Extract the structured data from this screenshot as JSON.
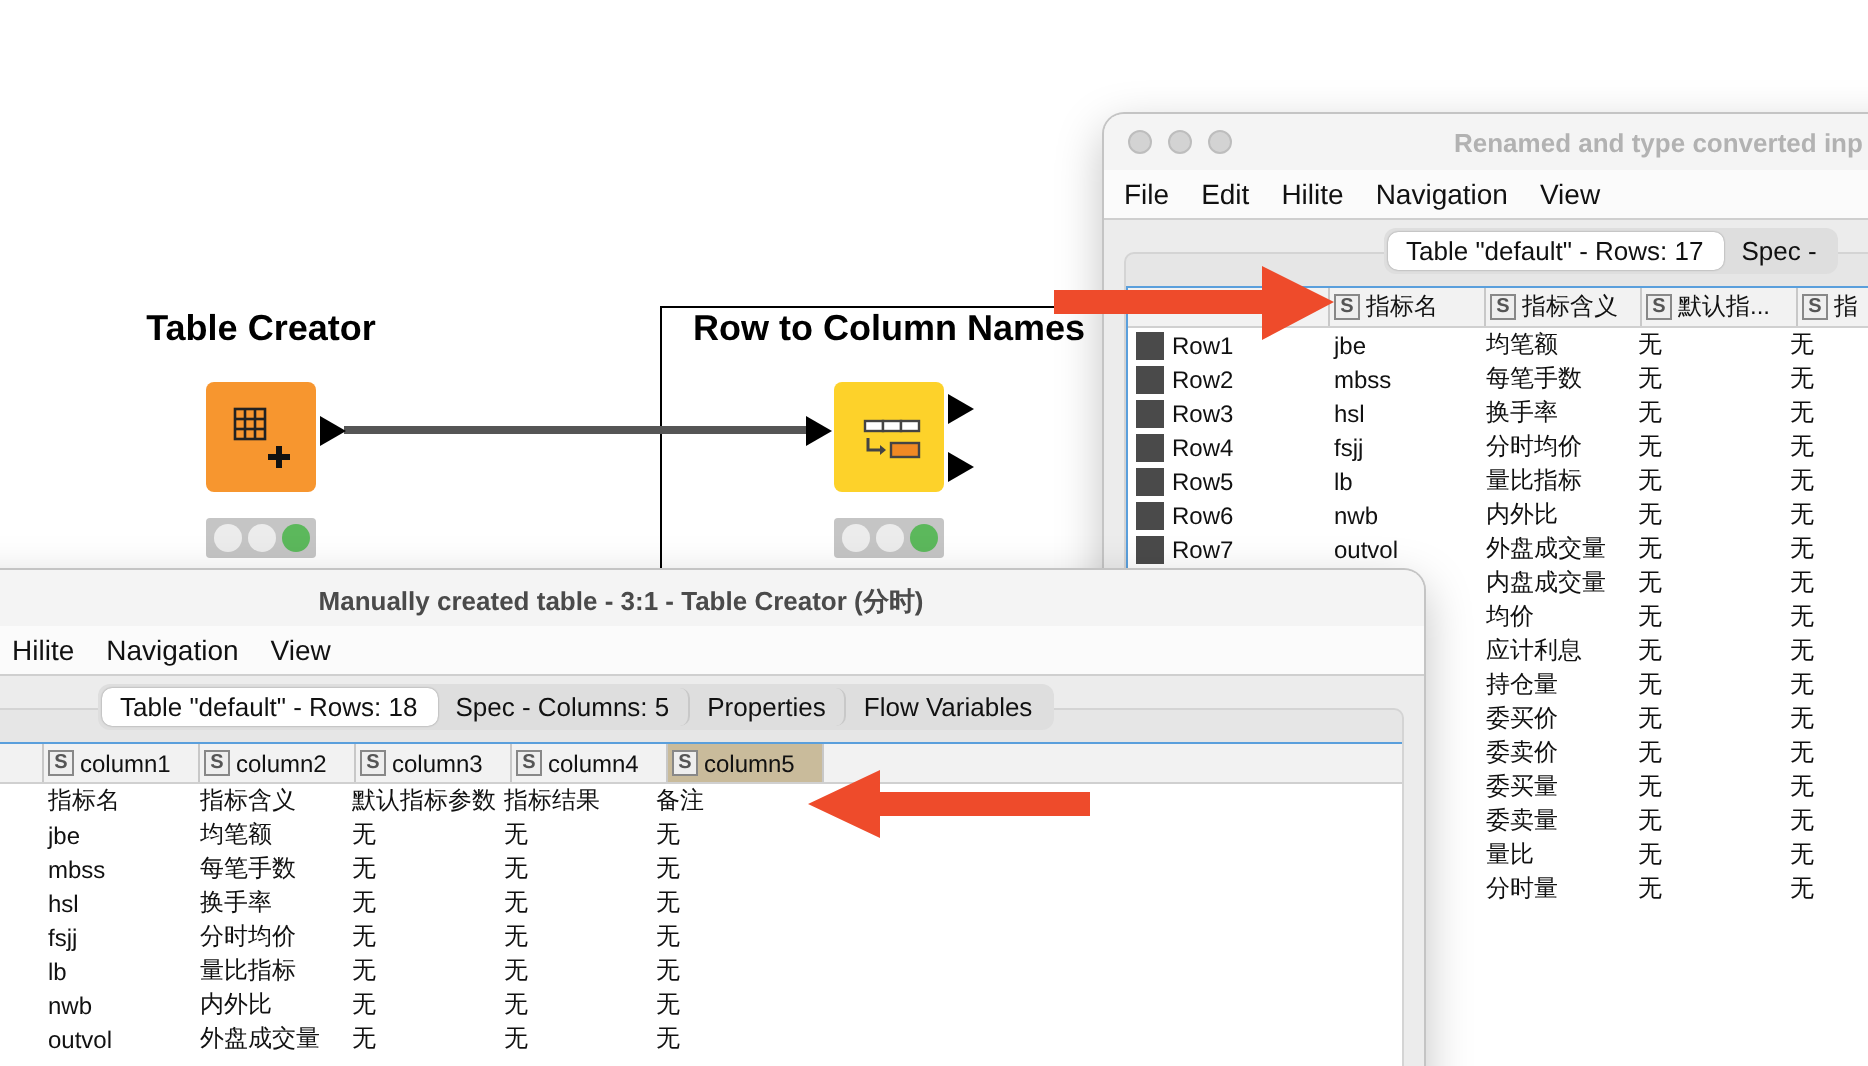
{
  "canvas": {
    "nodes": [
      {
        "label": "Table Creator",
        "kind": "table-creator",
        "lights": [
          {
            "on": false
          },
          {
            "on": false
          },
          {
            "on": true
          }
        ]
      },
      {
        "label": "Row to Column Names",
        "kind": "row-to-column-names",
        "lights": [
          {
            "on": false
          },
          {
            "on": false
          },
          {
            "on": true
          }
        ]
      }
    ]
  },
  "windows": [
    {
      "title": "Renamed and type converted inp",
      "active": false,
      "menu": [
        "File",
        "Edit",
        "Hilite",
        "Navigation",
        "View"
      ],
      "tabs": [
        {
          "label": "Table \"default\" - Rows: 17",
          "selected": true
        },
        {
          "label": "Spec -",
          "selected": false
        }
      ],
      "table": {
        "columns": [
          {
            "type": "S",
            "name": "指标名",
            "selected": false
          },
          {
            "type": "S",
            "name": "指标含义",
            "selected": false
          },
          {
            "type": "S",
            "name": "默认指...",
            "selected": false
          },
          {
            "type": "S",
            "name": "指",
            "selected": false
          }
        ],
        "rows": [
          {
            "row_id": "Row1",
            "cells": [
              "jbe",
              "均笔额",
              "无",
              "无"
            ]
          },
          {
            "row_id": "Row2",
            "cells": [
              "mbss",
              "每笔手数",
              "无",
              "无"
            ]
          },
          {
            "row_id": "Row3",
            "cells": [
              "hsl",
              "换手率",
              "无",
              "无"
            ]
          },
          {
            "row_id": "Row4",
            "cells": [
              "fsjj",
              "分时均价",
              "无",
              "无"
            ]
          },
          {
            "row_id": "Row5",
            "cells": [
              "lb",
              "量比指标",
              "无",
              "无"
            ]
          },
          {
            "row_id": "Row6",
            "cells": [
              "nwb",
              "内外比",
              "无",
              "无"
            ]
          },
          {
            "row_id": "Row7",
            "cells": [
              "outvol",
              "外盘成交量",
              "无",
              "无"
            ]
          },
          {
            "cells": [
              "内盘成交量",
              "无",
              "无"
            ]
          },
          {
            "cells": [
              "均价",
              "无",
              "无"
            ]
          },
          {
            "cells": [
              "应计利息",
              "无",
              "无"
            ]
          },
          {
            "cells": [
              "持仓量",
              "无",
              "无"
            ]
          },
          {
            "cells": [
              "委买价",
              "无",
              "无"
            ]
          },
          {
            "cells": [
              "委卖价",
              "无",
              "无"
            ]
          },
          {
            "cells": [
              "委买量",
              "无",
              "无"
            ]
          },
          {
            "cells": [
              "委卖量",
              "无",
              "无"
            ]
          },
          {
            "cells": [
              "量比",
              "无",
              "无"
            ]
          },
          {
            "cells": [
              "分时量",
              "无",
              "无"
            ]
          }
        ]
      }
    },
    {
      "title": "Manually created table - 3:1 - Table Creator (分时)",
      "active": true,
      "menu": [
        "Hilite",
        "Navigation",
        "View"
      ],
      "tabs": [
        {
          "label": "Table \"default\" - Rows: 18",
          "selected": true
        },
        {
          "label": "Spec - Columns: 5",
          "selected": false
        },
        {
          "label": "Properties",
          "selected": false
        },
        {
          "label": "Flow Variables",
          "selected": false
        }
      ],
      "table": {
        "columns": [
          {
            "type": "S",
            "name": "column1",
            "selected": false
          },
          {
            "type": "S",
            "name": "column2",
            "selected": false
          },
          {
            "type": "S",
            "name": "column3",
            "selected": false
          },
          {
            "type": "S",
            "name": "column4",
            "selected": false
          },
          {
            "type": "S",
            "name": "column5",
            "selected": true
          }
        ],
        "rows": [
          {
            "cells": [
              "指标名",
              "指标含义",
              "默认指标参数",
              "指标结果",
              "备注"
            ]
          },
          {
            "cells": [
              "jbe",
              "均笔额",
              "无",
              "无",
              "无"
            ]
          },
          {
            "cells": [
              "mbss",
              "每笔手数",
              "无",
              "无",
              "无"
            ]
          },
          {
            "cells": [
              "hsl",
              "换手率",
              "无",
              "无",
              "无"
            ]
          },
          {
            "cells": [
              "fsjj",
              "分时均价",
              "无",
              "无",
              "无"
            ]
          },
          {
            "cells": [
              "lb",
              "量比指标",
              "无",
              "无",
              "无"
            ]
          },
          {
            "cells": [
              "nwb",
              "内外比",
              "无",
              "无",
              "无"
            ]
          },
          {
            "cells": [
              "outvol",
              "外盘成交量",
              "无",
              "无",
              "无"
            ]
          }
        ]
      }
    }
  ]
}
